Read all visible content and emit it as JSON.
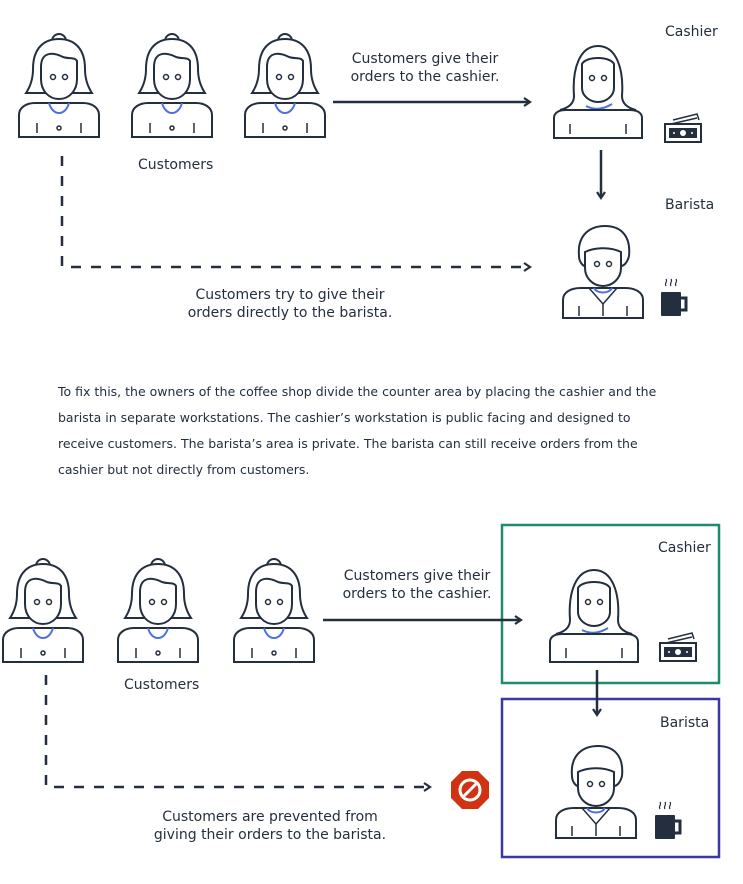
{
  "diagram1": {
    "customers_label": "Customers",
    "cashier_label": "Cashier",
    "barista_label": "Barista",
    "arrow_cashier_line1": "Customers give their",
    "arrow_cashier_line2": "orders to the cashier.",
    "arrow_barista_line1": "Customers try to give their",
    "arrow_barista_line2": "orders directly to the barista."
  },
  "paragraph": "To fix this, the owners of the coffee shop divide the counter area by placing the cashier and the barista in separate workstations. The cashier’s workstation is public facing and designed to receive customers. The barista’s area is private. The barista can still receive orders from the cashier but not directly from customers.",
  "diagram2": {
    "customers_label": "Customers",
    "cashier_label": "Cashier",
    "barista_label": "Barista",
    "arrow_cashier_line1": "Customers give their",
    "arrow_cashier_line2": "orders to the cashier.",
    "blocked_line1": "Customers are prevented from",
    "blocked_line2": "giving their orders to the barista."
  },
  "colors": {
    "cashier_box": "#1e8a6e",
    "barista_box": "#3b38a6",
    "blocked_icon": "#d13212",
    "accent_blue": "#4d6fe0"
  }
}
